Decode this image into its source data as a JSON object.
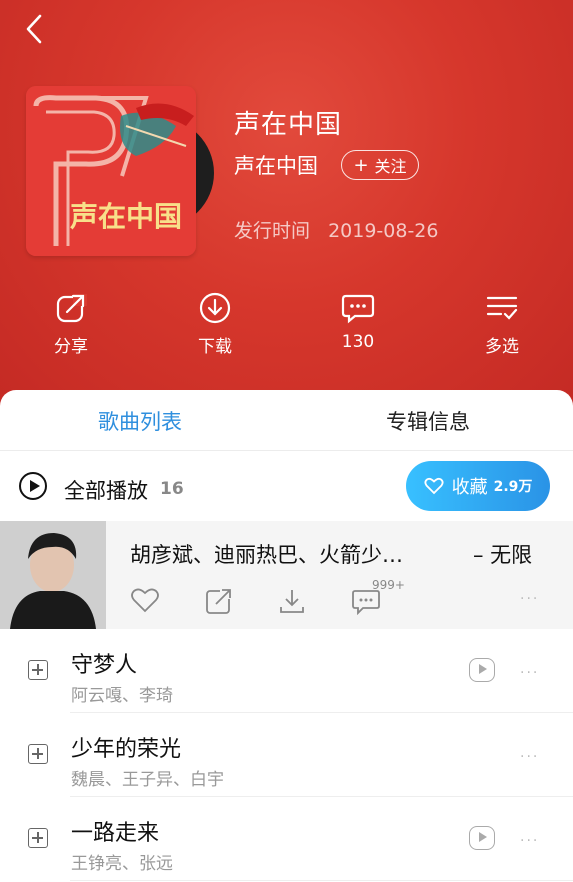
{
  "header": {
    "album_title": "声在中国",
    "artist": "声在中国",
    "follow_label": "关注",
    "release_label": "发行时间",
    "release_date": "2019-08-26",
    "cover_text": "声在中国"
  },
  "actions": [
    {
      "label": "分享",
      "icon": "share-icon"
    },
    {
      "label": "下载",
      "icon": "download-icon"
    },
    {
      "label": "130",
      "icon": "comment-icon"
    },
    {
      "label": "多选",
      "icon": "multi-select-icon"
    }
  ],
  "tabs": {
    "songs": "歌曲列表",
    "album_info": "专辑信息"
  },
  "play_all": {
    "label": "全部播放",
    "count": "16"
  },
  "collect": {
    "label": "收藏",
    "count": "2.9万"
  },
  "featured": {
    "artists": "胡彦斌、迪丽热巴、火箭少…",
    "title": "– 无限",
    "comment_badge": "999+"
  },
  "songs": [
    {
      "title": "守梦人",
      "artists": "阿云嘎、李琦",
      "has_play": true
    },
    {
      "title": "少年的荣光",
      "artists": "魏晨、王子异、白宇",
      "has_play": false
    },
    {
      "title": "一路走来",
      "artists": "王铮亮、张远",
      "has_play": true
    }
  ],
  "colors": {
    "header_red": "#d6372c",
    "accent_blue": "#2f8fde"
  }
}
